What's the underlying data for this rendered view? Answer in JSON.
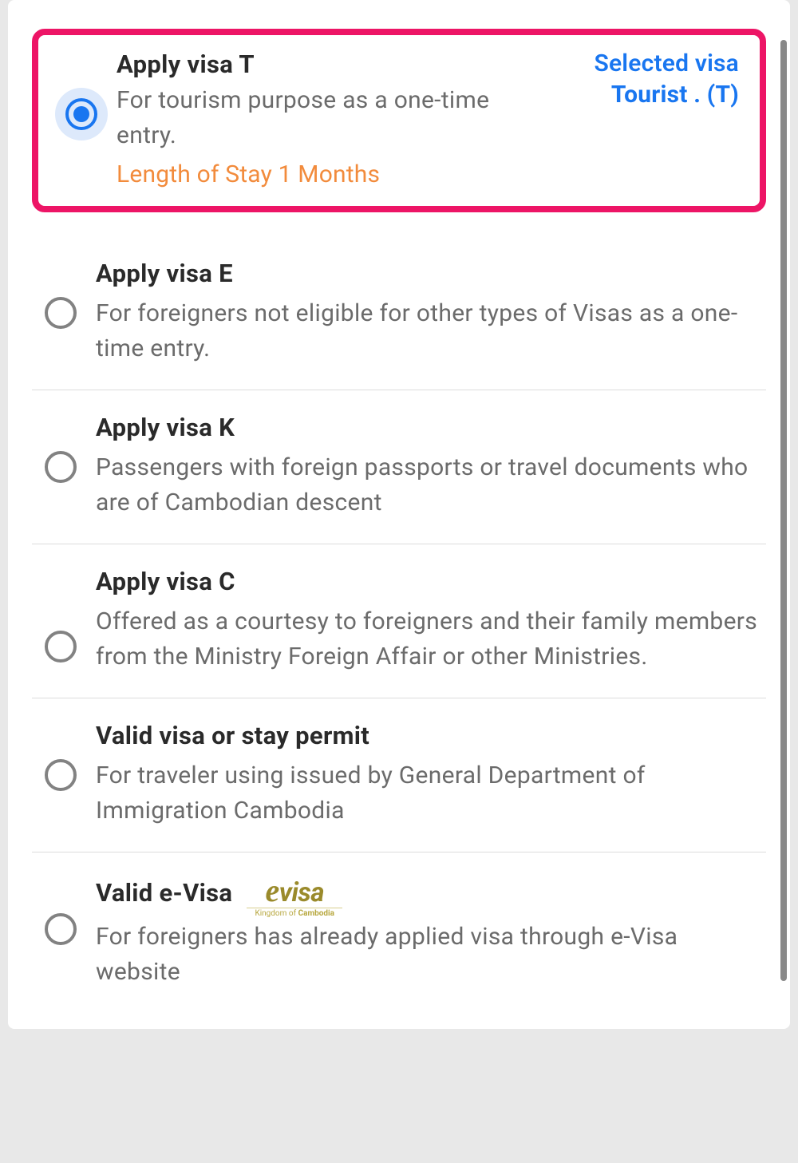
{
  "selected_visa": {
    "label": "Selected visa",
    "value": "Tourist . (T)"
  },
  "options": [
    {
      "title": "Apply visa T",
      "desc": "For tourism purpose as a one-time entry.",
      "length": "Length of Stay 1 Months",
      "selected": true
    },
    {
      "title": "Apply visa E",
      "desc": "For foreigners not eligible for other types of Visas as a one-time entry."
    },
    {
      "title": "Apply visa K",
      "desc": "Passengers with foreign passports or travel documents who are of Cambodian descent"
    },
    {
      "title": "Apply visa C",
      "desc": "Offered as a courtesy to foreigners and their family members from the Ministry Foreign Affair or other Ministries."
    },
    {
      "title": "Valid visa or stay permit",
      "desc": "For traveler using issued by General Department of Immigration Cambodia"
    },
    {
      "title": "Valid e-Visa",
      "desc": "For foreigners has already applied visa through e-Visa website",
      "logo": {
        "brand": "visa",
        "prefix": "e",
        "sub_prefix": "Kingdom of ",
        "sub_bold": "Cambodia"
      }
    }
  ]
}
